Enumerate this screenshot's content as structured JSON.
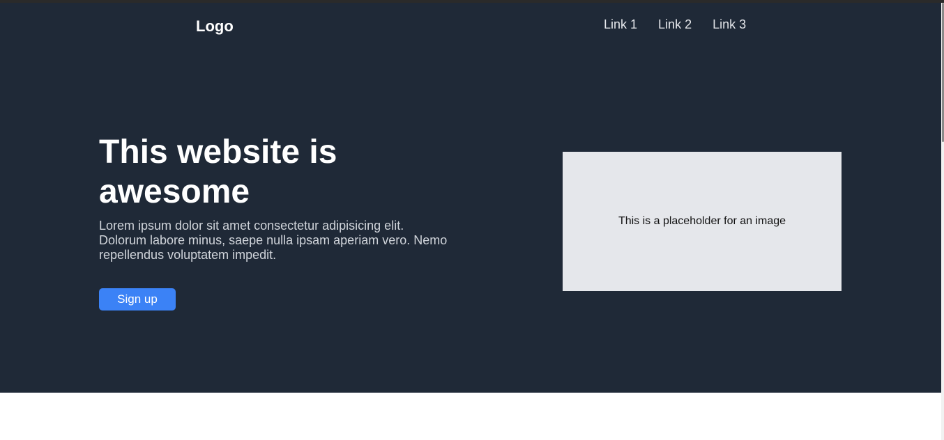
{
  "header": {
    "logo": "Logo",
    "nav": [
      "Link 1",
      "Link 2",
      "Link 3"
    ]
  },
  "hero": {
    "title": "This website is awesome",
    "description": "Lorem ipsum dolor sit amet consectetur adipisicing elit. Dolorum labore minus, saepe nulla ipsam aperiam vero. Nemo repellendus voluptatem impedit.",
    "cta_label": "Sign up",
    "image_placeholder": "This is a placeholder for an image"
  },
  "colors": {
    "hero_background": "#1f2937",
    "button": "#3b82f6",
    "placeholder": "#e5e7eb"
  }
}
